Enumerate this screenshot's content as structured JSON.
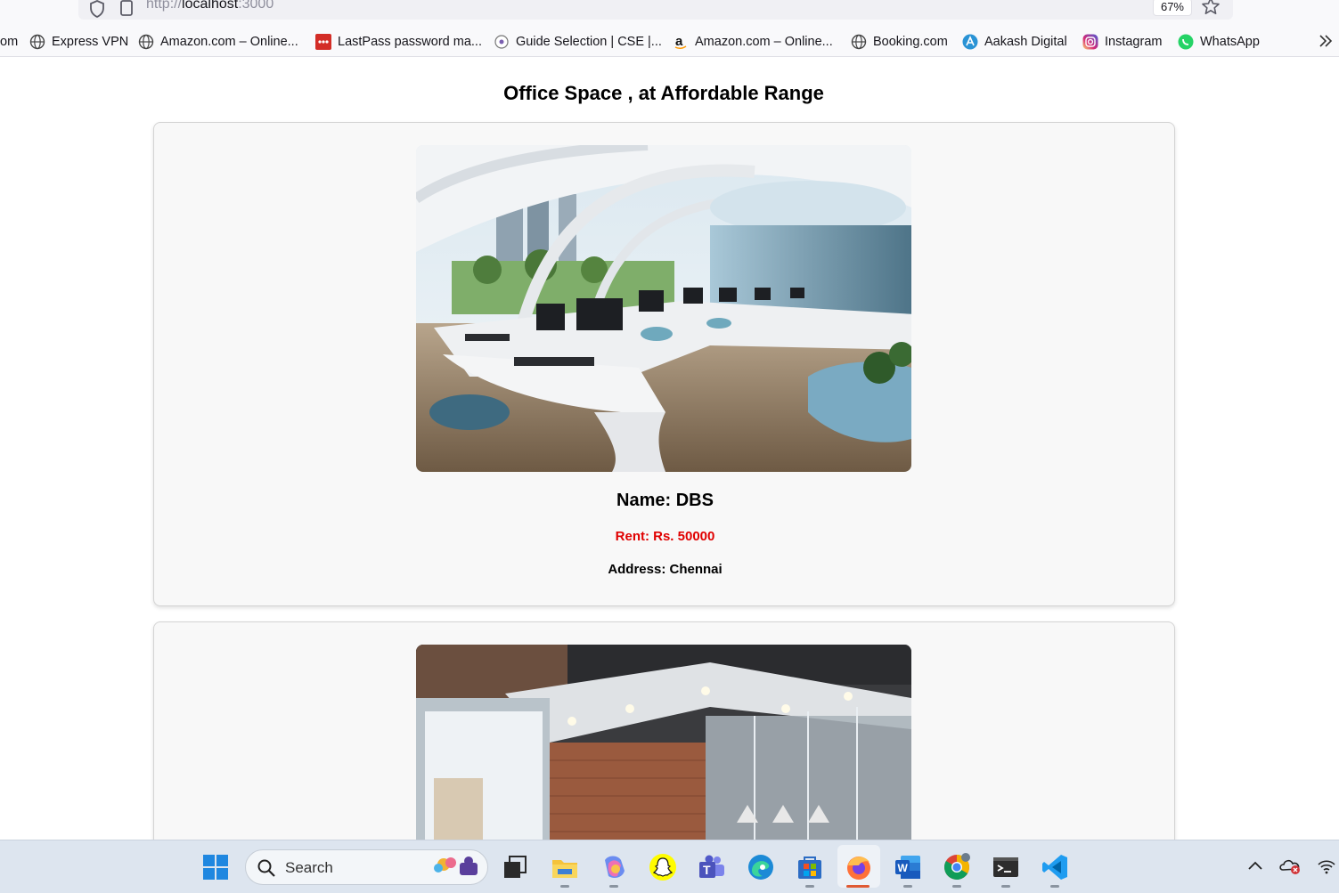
{
  "browser": {
    "url_prefix": "http://",
    "url_host": "localhost",
    "url_port": ":3000",
    "zoom": "67%",
    "bookmarks": [
      {
        "label": "om",
        "icon": "none"
      },
      {
        "label": "Express VPN",
        "icon": "globe-icon"
      },
      {
        "label": "Amazon.com – Online...",
        "icon": "globe-icon"
      },
      {
        "label": "LastPass password ma...",
        "icon": "lastpass-icon"
      },
      {
        "label": "Guide Selection | CSE |...",
        "icon": "guide-icon"
      },
      {
        "label": "Amazon.com – Online...",
        "icon": "amazon-icon"
      },
      {
        "label": "Booking.com",
        "icon": "globe-icon"
      },
      {
        "label": "Aakash Digital",
        "icon": "aakash-icon"
      },
      {
        "label": "Instagram",
        "icon": "instagram-icon"
      },
      {
        "label": "WhatsApp",
        "icon": "whatsapp-icon"
      }
    ]
  },
  "page": {
    "title": "Office Space , at Affordable Range",
    "listings": [
      {
        "name": "Name: DBS",
        "rent": "Rent: Rs. 50000",
        "address": "Address: Chennai"
      }
    ]
  },
  "taskbar": {
    "search_label": "Search",
    "apps": [
      "windows-start-icon",
      "widgets-icon",
      "task-view-icon",
      "file-explorer-icon",
      "copilot-icon",
      "snapchat-icon",
      "teams-icon",
      "edge-icon",
      "store-icon",
      "firefox-icon",
      "word-icon",
      "chrome-icon",
      "terminal-icon",
      "vscode-icon"
    ]
  },
  "colors": {
    "rent": "#e00000",
    "card_bg": "#f8f8f8",
    "taskbar_bg": "#dde5ef"
  }
}
